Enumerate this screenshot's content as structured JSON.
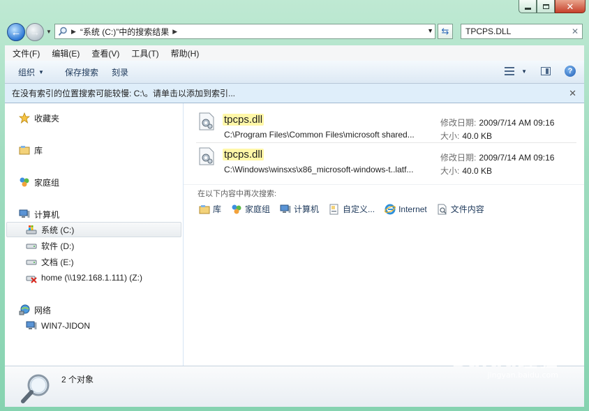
{
  "window": {
    "address_path": "“系统 (C:)”中的搜索结果",
    "search_value": "TPCPS.DLL"
  },
  "menu": [
    "文件(F)",
    "编辑(E)",
    "查看(V)",
    "工具(T)",
    "帮助(H)"
  ],
  "toolbar": {
    "organize": "组织",
    "save_search": "保存搜索",
    "burn": "刻录"
  },
  "infobar": {
    "message": "在没有索引的位置搜索可能较慢: C:\\。请单击以添加到索引..."
  },
  "nav": {
    "favorites": "收藏夹",
    "libraries": "库",
    "homegroup": "家庭组",
    "computer": "计算机",
    "drives": [
      "系统 (C:)",
      "软件 (D:)",
      "文档 (E:)",
      "home (\\\\192.168.1.111) (Z:)"
    ],
    "network": "网络",
    "network_pc": "WIN7-JIDON"
  },
  "results": [
    {
      "name": "tpcps.dll",
      "path": "C:\\Program Files\\Common Files\\microsoft shared...",
      "modified_label": "修改日期:",
      "modified": "2009/7/14 AM 09:16",
      "size_label": "大小:",
      "size": "40.0 KB"
    },
    {
      "name": "tpcps.dll",
      "path": "C:\\Windows\\winsxs\\x86_microsoft-windows-t..latf...",
      "modified_label": "修改日期:",
      "modified": "2009/7/14 AM 09:16",
      "size_label": "大小:",
      "size": "40.0 KB"
    }
  ],
  "search_again": {
    "label": "在以下内容中再次搜索:",
    "options": [
      "库",
      "家庭组",
      "计算机",
      "自定义...",
      "Internet",
      "文件内容"
    ]
  },
  "details": {
    "count": "2 个对象"
  },
  "watermark": {
    "logo": "Baidu经验",
    "url": "jingyan.baidu.com"
  }
}
